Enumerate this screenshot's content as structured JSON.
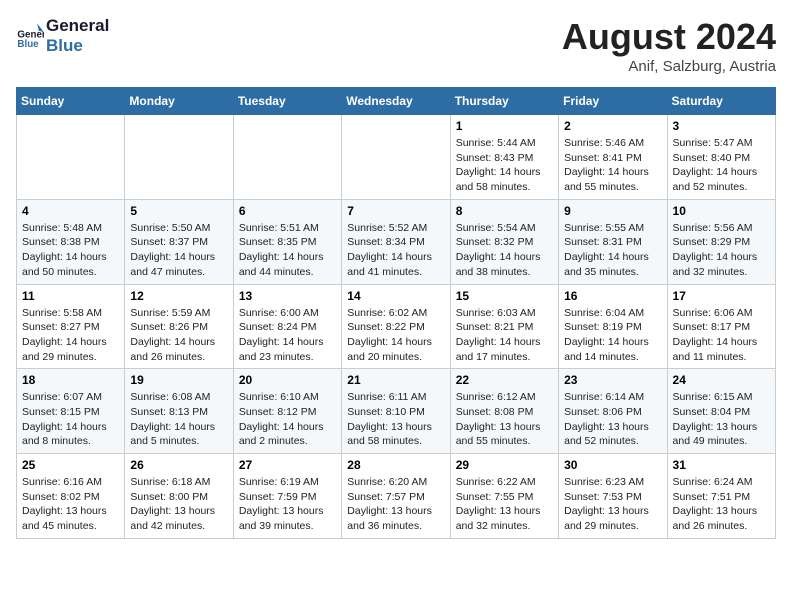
{
  "header": {
    "logo_line1": "General",
    "logo_line2": "Blue",
    "month": "August 2024",
    "location": "Anif, Salzburg, Austria"
  },
  "weekdays": [
    "Sunday",
    "Monday",
    "Tuesday",
    "Wednesday",
    "Thursday",
    "Friday",
    "Saturday"
  ],
  "weeks": [
    [
      {
        "day": "",
        "info": ""
      },
      {
        "day": "",
        "info": ""
      },
      {
        "day": "",
        "info": ""
      },
      {
        "day": "",
        "info": ""
      },
      {
        "day": "1",
        "info": "Sunrise: 5:44 AM\nSunset: 8:43 PM\nDaylight: 14 hours\nand 58 minutes."
      },
      {
        "day": "2",
        "info": "Sunrise: 5:46 AM\nSunset: 8:41 PM\nDaylight: 14 hours\nand 55 minutes."
      },
      {
        "day": "3",
        "info": "Sunrise: 5:47 AM\nSunset: 8:40 PM\nDaylight: 14 hours\nand 52 minutes."
      }
    ],
    [
      {
        "day": "4",
        "info": "Sunrise: 5:48 AM\nSunset: 8:38 PM\nDaylight: 14 hours\nand 50 minutes."
      },
      {
        "day": "5",
        "info": "Sunrise: 5:50 AM\nSunset: 8:37 PM\nDaylight: 14 hours\nand 47 minutes."
      },
      {
        "day": "6",
        "info": "Sunrise: 5:51 AM\nSunset: 8:35 PM\nDaylight: 14 hours\nand 44 minutes."
      },
      {
        "day": "7",
        "info": "Sunrise: 5:52 AM\nSunset: 8:34 PM\nDaylight: 14 hours\nand 41 minutes."
      },
      {
        "day": "8",
        "info": "Sunrise: 5:54 AM\nSunset: 8:32 PM\nDaylight: 14 hours\nand 38 minutes."
      },
      {
        "day": "9",
        "info": "Sunrise: 5:55 AM\nSunset: 8:31 PM\nDaylight: 14 hours\nand 35 minutes."
      },
      {
        "day": "10",
        "info": "Sunrise: 5:56 AM\nSunset: 8:29 PM\nDaylight: 14 hours\nand 32 minutes."
      }
    ],
    [
      {
        "day": "11",
        "info": "Sunrise: 5:58 AM\nSunset: 8:27 PM\nDaylight: 14 hours\nand 29 minutes."
      },
      {
        "day": "12",
        "info": "Sunrise: 5:59 AM\nSunset: 8:26 PM\nDaylight: 14 hours\nand 26 minutes."
      },
      {
        "day": "13",
        "info": "Sunrise: 6:00 AM\nSunset: 8:24 PM\nDaylight: 14 hours\nand 23 minutes."
      },
      {
        "day": "14",
        "info": "Sunrise: 6:02 AM\nSunset: 8:22 PM\nDaylight: 14 hours\nand 20 minutes."
      },
      {
        "day": "15",
        "info": "Sunrise: 6:03 AM\nSunset: 8:21 PM\nDaylight: 14 hours\nand 17 minutes."
      },
      {
        "day": "16",
        "info": "Sunrise: 6:04 AM\nSunset: 8:19 PM\nDaylight: 14 hours\nand 14 minutes."
      },
      {
        "day": "17",
        "info": "Sunrise: 6:06 AM\nSunset: 8:17 PM\nDaylight: 14 hours\nand 11 minutes."
      }
    ],
    [
      {
        "day": "18",
        "info": "Sunrise: 6:07 AM\nSunset: 8:15 PM\nDaylight: 14 hours\nand 8 minutes."
      },
      {
        "day": "19",
        "info": "Sunrise: 6:08 AM\nSunset: 8:13 PM\nDaylight: 14 hours\nand 5 minutes."
      },
      {
        "day": "20",
        "info": "Sunrise: 6:10 AM\nSunset: 8:12 PM\nDaylight: 14 hours\nand 2 minutes."
      },
      {
        "day": "21",
        "info": "Sunrise: 6:11 AM\nSunset: 8:10 PM\nDaylight: 13 hours\nand 58 minutes."
      },
      {
        "day": "22",
        "info": "Sunrise: 6:12 AM\nSunset: 8:08 PM\nDaylight: 13 hours\nand 55 minutes."
      },
      {
        "day": "23",
        "info": "Sunrise: 6:14 AM\nSunset: 8:06 PM\nDaylight: 13 hours\nand 52 minutes."
      },
      {
        "day": "24",
        "info": "Sunrise: 6:15 AM\nSunset: 8:04 PM\nDaylight: 13 hours\nand 49 minutes."
      }
    ],
    [
      {
        "day": "25",
        "info": "Sunrise: 6:16 AM\nSunset: 8:02 PM\nDaylight: 13 hours\nand 45 minutes."
      },
      {
        "day": "26",
        "info": "Sunrise: 6:18 AM\nSunset: 8:00 PM\nDaylight: 13 hours\nand 42 minutes."
      },
      {
        "day": "27",
        "info": "Sunrise: 6:19 AM\nSunset: 7:59 PM\nDaylight: 13 hours\nand 39 minutes."
      },
      {
        "day": "28",
        "info": "Sunrise: 6:20 AM\nSunset: 7:57 PM\nDaylight: 13 hours\nand 36 minutes."
      },
      {
        "day": "29",
        "info": "Sunrise: 6:22 AM\nSunset: 7:55 PM\nDaylight: 13 hours\nand 32 minutes."
      },
      {
        "day": "30",
        "info": "Sunrise: 6:23 AM\nSunset: 7:53 PM\nDaylight: 13 hours\nand 29 minutes."
      },
      {
        "day": "31",
        "info": "Sunrise: 6:24 AM\nSunset: 7:51 PM\nDaylight: 13 hours\nand 26 minutes."
      }
    ]
  ]
}
